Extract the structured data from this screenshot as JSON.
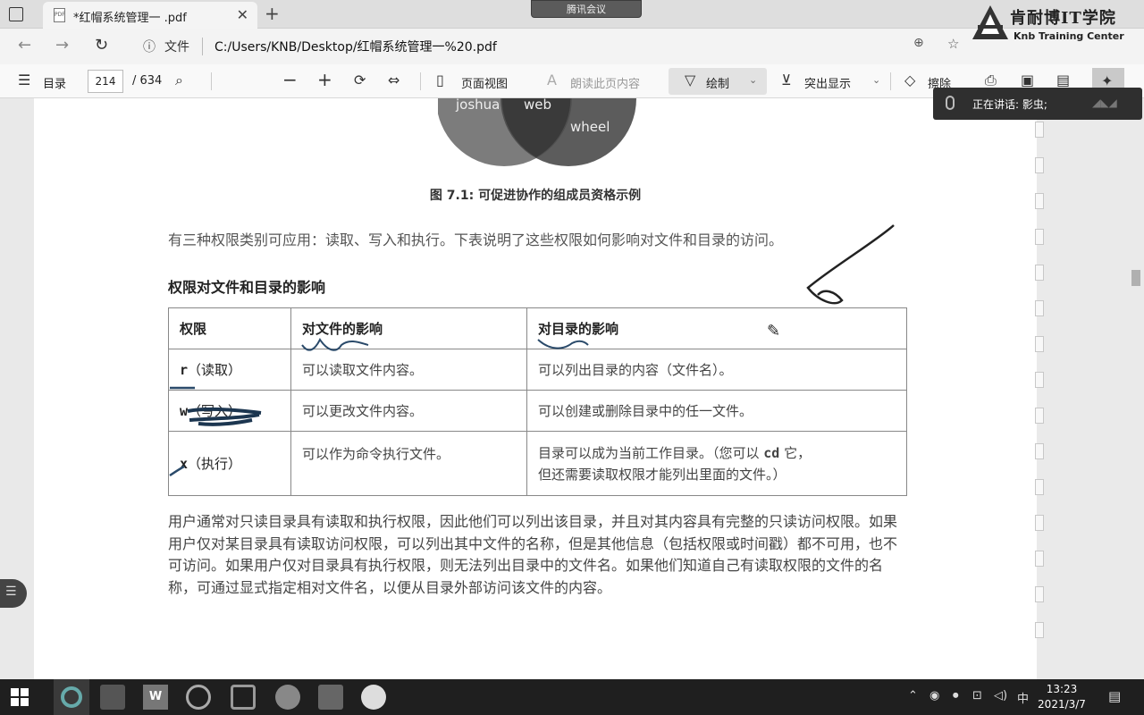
{
  "browser": {
    "tab_title": "*红帽系统管理一 .pdf",
    "meeting_label": "腾讯会议",
    "info_label": "文件",
    "url": "C:/Users/KNB/Desktop/红帽系统管理一%20.pdf",
    "brand_name": "肯耐博IT学院",
    "brand_sub": "Knb Training Center"
  },
  "pdf_toolbar": {
    "toc_label": "目录",
    "page_current": "214",
    "page_total": "/ 634",
    "page_view_label": "页面视图",
    "read_aloud_label": "朗读此页内容",
    "draw_label": "绘制",
    "highlight_label": "突出显示",
    "erase_label": "擦除"
  },
  "speaker": {
    "text": "正在讲话: 影虫;"
  },
  "document": {
    "venn_labels": [
      "joshua",
      "web",
      "wheel"
    ],
    "figure_caption": "图 7.1: 可促进协作的组成员资格示例",
    "intro": "有三种权限类别可应用：读取、写入和执行。下表说明了这些权限如何影响对文件和目录的访问。",
    "section_title": "权限对文件和目录的影响",
    "table": {
      "headers": [
        "权限",
        "对文件的影响",
        "对目录的影响"
      ],
      "rows": [
        {
          "perm_code": "r",
          "perm_name": "（读取）",
          "file": "可以读取文件内容。",
          "dir": "可以列出目录的内容（文件名）。"
        },
        {
          "perm_code": "w",
          "perm_name": "（写入）",
          "file": "可以更改文件内容。",
          "dir": "可以创建或删除目录中的任一文件。"
        },
        {
          "perm_code": "x",
          "perm_name": "（执行）",
          "file": "可以作为命令执行文件。",
          "dir_line1_pre": "目录可以成为当前工作目录。（您可以 ",
          "dir_cmd": "cd",
          "dir_line1_post": " 它，",
          "dir_line2": "但还需要读取权限才能列出里面的文件。）"
        }
      ]
    },
    "paragraph": "用户通常对只读目录具有读取和执行权限，因此他们可以列出该目录，并且对其内容具有完整的只读访问权限。如果用户仅对某目录具有读取访问权限，可以列出其中文件的名称，但是其他信息（包括权限或时间戳）都不可用，也不可访问。如果用户仅对目录具有执行权限，则无法列出目录中的文件名。如果他们知道自己有读取权限的文件的名称，可通过显式指定相对文件名，以便从目录外部访问该文件的内容。"
  },
  "taskbar": {
    "ime": "中",
    "time": "13:23",
    "date": "2021/3/7"
  }
}
